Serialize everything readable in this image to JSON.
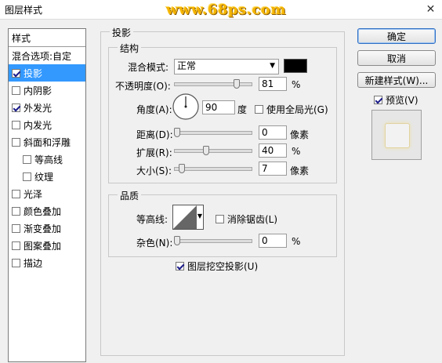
{
  "window": {
    "title": "图层样式",
    "watermark": "www.68ps.com",
    "close_symbol": "✕"
  },
  "sidebar": {
    "header": "样式",
    "items": [
      {
        "label": "混合选项:自定",
        "checkbox": false,
        "checked": false,
        "selected": false,
        "indent": false
      },
      {
        "label": "投影",
        "checkbox": true,
        "checked": true,
        "selected": true,
        "indent": false
      },
      {
        "label": "内阴影",
        "checkbox": true,
        "checked": false,
        "selected": false,
        "indent": false
      },
      {
        "label": "外发光",
        "checkbox": true,
        "checked": true,
        "selected": false,
        "indent": false
      },
      {
        "label": "内发光",
        "checkbox": true,
        "checked": false,
        "selected": false,
        "indent": false
      },
      {
        "label": "斜面和浮雕",
        "checkbox": true,
        "checked": false,
        "selected": false,
        "indent": false
      },
      {
        "label": "等高线",
        "checkbox": true,
        "checked": false,
        "selected": false,
        "indent": true
      },
      {
        "label": "纹理",
        "checkbox": true,
        "checked": false,
        "selected": false,
        "indent": true
      },
      {
        "label": "光泽",
        "checkbox": true,
        "checked": false,
        "selected": false,
        "indent": false
      },
      {
        "label": "颜色叠加",
        "checkbox": true,
        "checked": false,
        "selected": false,
        "indent": false
      },
      {
        "label": "渐变叠加",
        "checkbox": true,
        "checked": false,
        "selected": false,
        "indent": false
      },
      {
        "label": "图案叠加",
        "checkbox": true,
        "checked": false,
        "selected": false,
        "indent": false
      },
      {
        "label": "描边",
        "checkbox": true,
        "checked": false,
        "selected": false,
        "indent": false
      }
    ]
  },
  "shadow": {
    "section_title": "投影",
    "structure": {
      "title": "结构",
      "blend_mode_label": "混合模式:",
      "blend_mode_value": "正常",
      "shadow_color": "#000000",
      "opacity_label": "不透明度(O):",
      "opacity_value": "81",
      "opacity_unit": "%",
      "angle_label": "角度(A):",
      "angle_value": "90",
      "angle_unit": "度",
      "global_light_label": "使用全局光(G)",
      "global_light_checked": false,
      "distance_label": "距离(D):",
      "distance_value": "0",
      "distance_unit": "像素",
      "spread_label": "扩展(R):",
      "spread_value": "40",
      "spread_unit": "%",
      "size_label": "大小(S):",
      "size_value": "7",
      "size_unit": "像素"
    },
    "quality": {
      "title": "品质",
      "contour_label": "等高线:",
      "antialias_label": "消除锯齿(L)",
      "antialias_checked": false,
      "noise_label": "杂色(N):",
      "noise_value": "0",
      "noise_unit": "%"
    },
    "knockout_label": "图层挖空投影(U)",
    "knockout_checked": true
  },
  "buttons": {
    "ok": "确定",
    "cancel": "取消",
    "new_style": "新建样式(W)...",
    "preview": "预览(V)",
    "preview_checked": true
  },
  "colors": {
    "selection": "#3399ff",
    "watermark": "#f5b400"
  }
}
